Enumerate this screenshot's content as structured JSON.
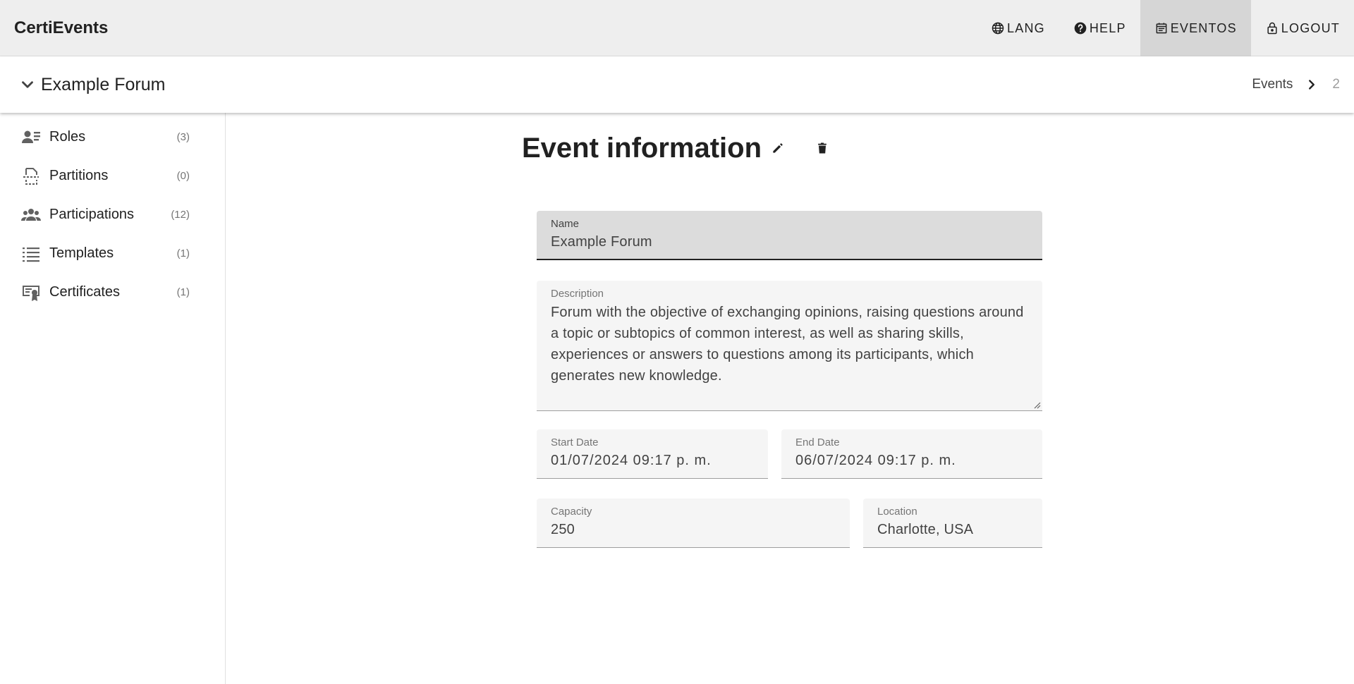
{
  "app": {
    "brand": "CertiEvents"
  },
  "nav": {
    "lang": "LANG",
    "help": "HELP",
    "eventos": "EVENTOS",
    "logout": "LOGOUT"
  },
  "subheader": {
    "event_title": "Example Forum",
    "breadcrumb": {
      "link": "Events",
      "current": "2"
    }
  },
  "sidebar": {
    "items": [
      {
        "label": "Roles",
        "count": "(3)",
        "icon": "roles-icon"
      },
      {
        "label": "Partitions",
        "count": "(0)",
        "icon": "partitions-icon"
      },
      {
        "label": "Participations",
        "count": "(12)",
        "icon": "participations-icon"
      },
      {
        "label": "Templates",
        "count": "(1)",
        "icon": "templates-icon"
      },
      {
        "label": "Certificates",
        "count": "(1)",
        "icon": "certificates-icon"
      }
    ]
  },
  "main": {
    "title": "Event information",
    "form": {
      "name": {
        "label": "Name",
        "value": "Example Forum"
      },
      "description": {
        "label": "Description",
        "value": "Forum with the objective of exchanging opinions, raising questions around a topic or subtopics of common interest, as well as sharing skills, experiences or answers to questions among its participants, which generates new knowledge."
      },
      "start_date": {
        "label": "Start Date",
        "value": "01/07/2024 09:17 p. m."
      },
      "end_date": {
        "label": "End Date",
        "value": "06/07/2024 09:17 p. m."
      },
      "capacity": {
        "label": "Capacity",
        "value": "250"
      },
      "location": {
        "label": "Location",
        "value": "Charlotte, USA"
      }
    }
  },
  "colors": {
    "appbar_bg": "#eeeeee",
    "active_nav_bg": "#d6d6d6",
    "field_bg": "#f5f5f5",
    "focused_field_bg": "#dcdcdc"
  }
}
